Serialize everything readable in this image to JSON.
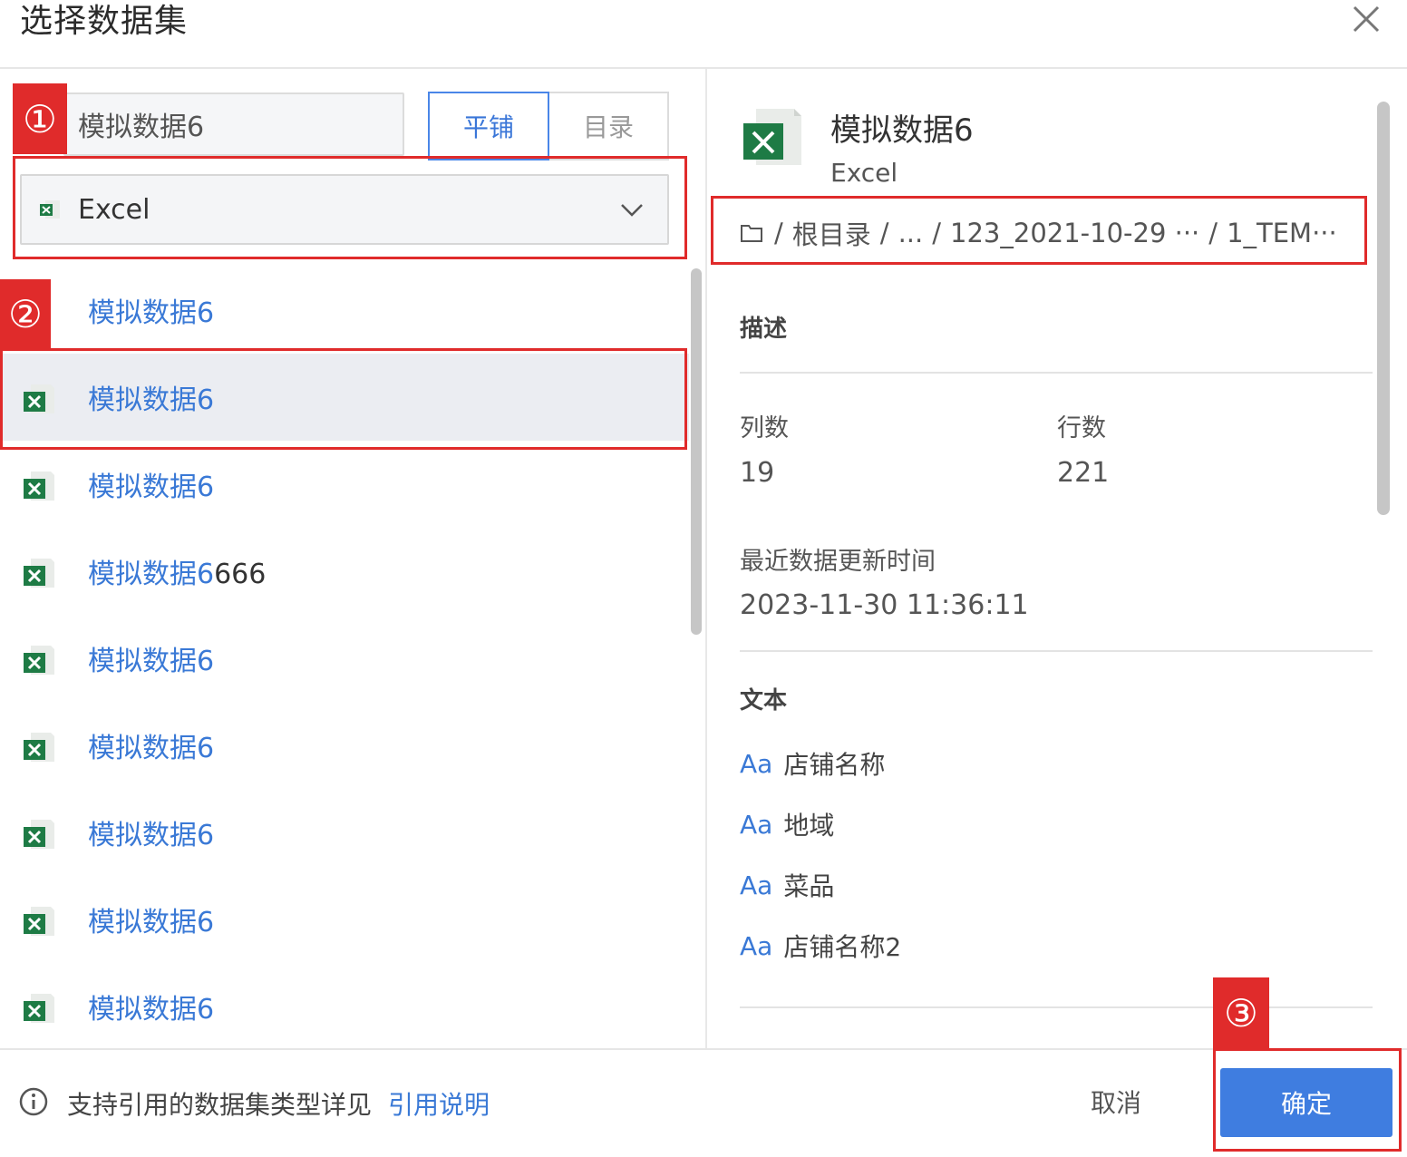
{
  "dialog": {
    "title": "选择数据集"
  },
  "left": {
    "search": {
      "value": "模拟数据6"
    },
    "view_tabs": [
      {
        "label": "平铺",
        "active": true
      },
      {
        "label": "目录",
        "active": false
      }
    ],
    "type_select": {
      "value": "Excel"
    },
    "items": [
      {
        "label": "模拟数据6"
      },
      {
        "label": "模拟数据6"
      },
      {
        "label": "模拟数据6"
      },
      {
        "label_match": "模拟数据6",
        "label_tail": "666"
      },
      {
        "label": "模拟数据6"
      },
      {
        "label": "模拟数据6"
      },
      {
        "label": "模拟数据6"
      },
      {
        "label": "模拟数据6"
      },
      {
        "label": "模拟数据6"
      }
    ]
  },
  "detail": {
    "name": "模拟数据6",
    "type": "Excel",
    "path": {
      "sep": "/",
      "root": "根目录",
      "ellipsis": "...",
      "folder1": "123_2021-10-29 ···",
      "folder2": "1_TEM···"
    },
    "description_label": "描述",
    "columns_label": "列数",
    "columns_value": "19",
    "rows_label": "行数",
    "rows_value": "221",
    "updated_label": "最近数据更新时间",
    "updated_value": "2023-11-30 11:36:11",
    "text_section_label": "文本",
    "fields": [
      {
        "type_glyph": "Aa",
        "name": "店铺名称"
      },
      {
        "type_glyph": "Aa",
        "name": "地域"
      },
      {
        "type_glyph": "Aa",
        "name": "菜品"
      },
      {
        "type_glyph": "Aa",
        "name": "店铺名称2"
      }
    ]
  },
  "footer": {
    "info_text": "支持引用的数据集类型详见",
    "info_link": "引用说明",
    "cancel": "取消",
    "confirm": "确定"
  },
  "annotations": {
    "badge1": "①",
    "badge2": "②",
    "badge3": "③",
    "color": "#e02b2b"
  },
  "colors": {
    "accent": "#3f7de0",
    "link": "#3a79d6",
    "excel_green": "#1e7b45",
    "selected_row": "#ebedf2"
  }
}
